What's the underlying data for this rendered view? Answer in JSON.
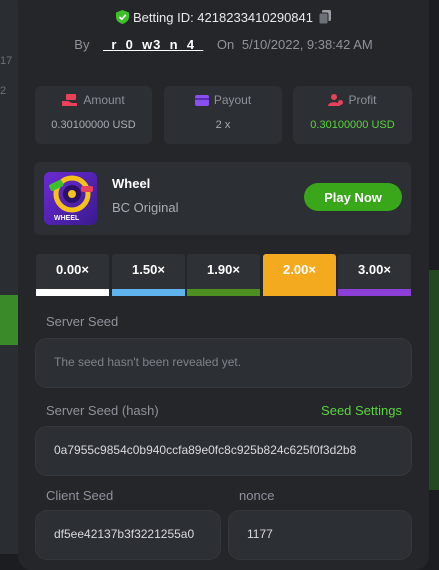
{
  "header": {
    "betting_id_label": "Betting ID: 4218233410290841",
    "by_label": "By",
    "username": "_r_0_w3_n_4_",
    "on_label": "On",
    "date": "5/10/2022, 9:38:42 AM"
  },
  "background": {
    "text1": "17",
    "text2": "2"
  },
  "stats": [
    {
      "label": "Amount",
      "value": "0.30100000 USD",
      "icon": "money-hand-icon"
    },
    {
      "label": "Payout",
      "value": "2 x",
      "icon": "card-icon"
    },
    {
      "label": "Profit",
      "value": "0.30100000 USD",
      "icon": "profit-person-icon"
    }
  ],
  "game": {
    "name": "Wheel",
    "subtitle": "BC Original",
    "play_label": "Play Now",
    "thumb_text": "WHEEL"
  },
  "multipliers": [
    {
      "label": "0.00×",
      "color": "#ffffff"
    },
    {
      "label": "1.50×",
      "color": "#5fb4ee"
    },
    {
      "label": "1.90×",
      "color": "#4d8f21"
    },
    {
      "label": "2.00×",
      "color": "#f4aa1f",
      "active": true
    },
    {
      "label": "3.00×",
      "color": "#8b3fd6"
    }
  ],
  "server_seed": {
    "label": "Server Seed",
    "placeholder": "The seed hasn't been revealed yet."
  },
  "server_seed_hash": {
    "label": "Server Seed (hash)",
    "link": "Seed Settings",
    "value": "0a7955c9854c0b940ccfa89e0fc8c925b824c625f0f3d2b8"
  },
  "client_seed": {
    "label": "Client Seed",
    "value": "df5ee42137b3f3221255a0"
  },
  "nonce": {
    "label": "nonce",
    "value": "1177"
  },
  "colors": {
    "accent_green": "#3aa61a",
    "profit_green": "#5bd43b",
    "panel": "#24262a",
    "card": "#2c2f33"
  }
}
